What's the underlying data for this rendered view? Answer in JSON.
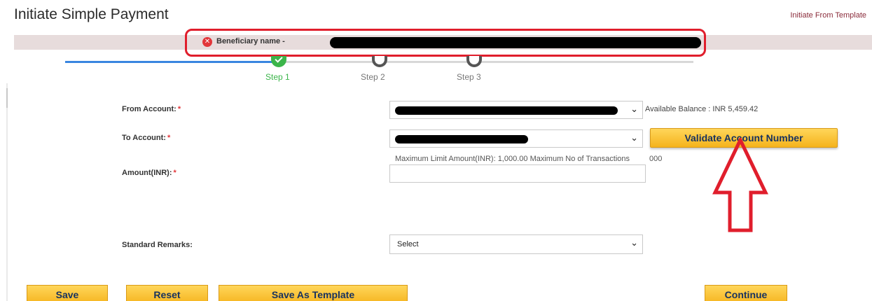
{
  "header": {
    "title": "Initiate Simple Payment",
    "template_link": "Initiate From Template"
  },
  "error": {
    "icon": "error-x-icon",
    "text": "Beneficiary name -"
  },
  "steps": [
    {
      "label": "Step 1",
      "state": "complete"
    },
    {
      "label": "Step 2",
      "state": "pending"
    },
    {
      "label": "Step 3",
      "state": "pending"
    }
  ],
  "form": {
    "from_account": {
      "label": "From Account:",
      "required": "*",
      "value": ""
    },
    "balance": "Available Balance : INR  5,459.42",
    "to_account": {
      "label": "To Account:",
      "required": "*",
      "value": ""
    },
    "validate_button": "Validate Account Number",
    "limit_info": "Maximum Limit Amount(INR):  1,000.00  Maximum No of Transactions",
    "limit_info_tail": "000",
    "amount": {
      "label": "Amount(INR):",
      "required": "*",
      "value": ""
    },
    "remarks": {
      "label": "Standard Remarks:",
      "value": "Select"
    }
  },
  "buttons": {
    "save": "Save",
    "reset": "Reset",
    "save_template": "Save As Template",
    "continue": "Continue"
  },
  "colors": {
    "accent_button": "#f5b31c",
    "annotation": "#e01e2c",
    "step_done": "#3bb54a",
    "progress": "#3a86e0"
  }
}
